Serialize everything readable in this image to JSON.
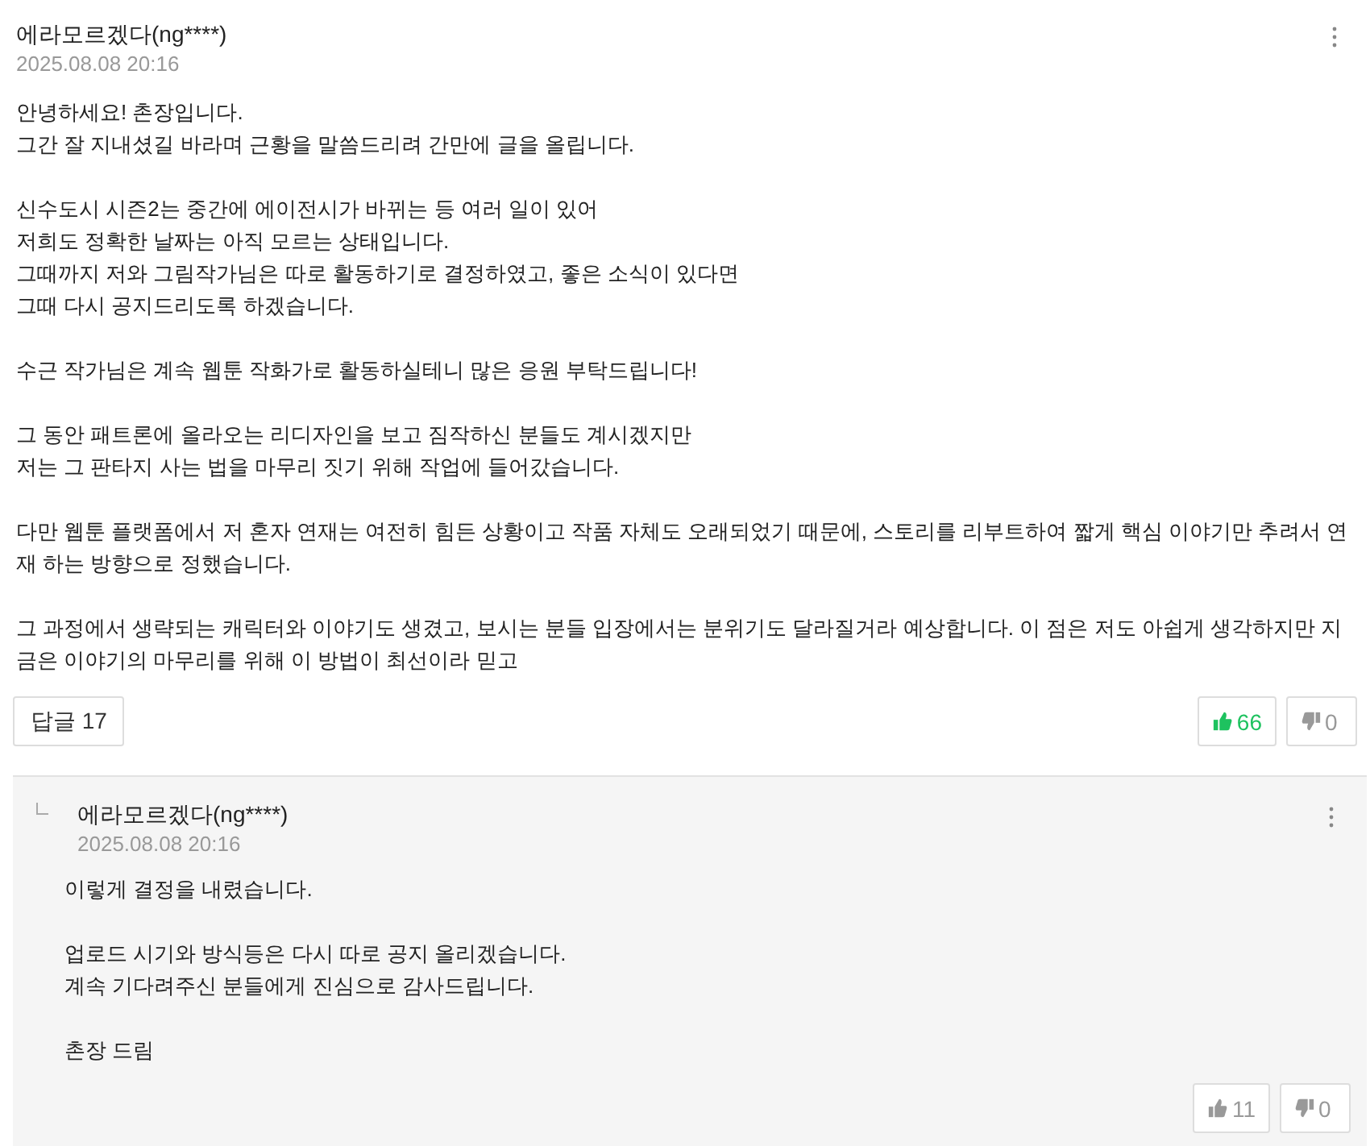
{
  "comment": {
    "author": "에라모르겠다(ng****)",
    "date": "2025.08.08 20:16",
    "paragraphs": [
      [
        "안녕하세요! 촌장입니다.",
        "그간 잘 지내셨길 바라며 근황을 말씀드리려 간만에 글을 올립니다."
      ],
      [
        "신수도시 시즌2는 중간에 에이전시가 바뀌는 등 여러 일이 있어",
        "저희도 정확한 날짜는 아직 모르는 상태입니다.",
        "그때까지 저와 그림작가님은 따로 활동하기로 결정하였고, 좋은 소식이 있다면",
        "그때 다시 공지드리도록 하겠습니다."
      ],
      [
        "수근 작가님은 계속 웹툰 작화가로 활동하실테니 많은 응원 부탁드립니다!"
      ],
      [
        "그 동안 패트론에 올라오는 리디자인을 보고 짐작하신 분들도 계시겠지만",
        "저는 그 판타지 사는 법을 마무리 짓기 위해 작업에 들어갔습니다."
      ],
      [
        "다만 웹툰 플랫폼에서 저 혼자 연재는 여전히 힘든 상황이고 작품 자체도 오래되었기 때문에, 스토리를 리부트하여 짧게 핵심 이야기만 추려서 연재 하는 방향으로 정했습니다."
      ],
      [
        "그 과정에서 생략되는 캐릭터와 이야기도 생겼고, 보시는 분들 입장에서는 분위기도 달라질거라 예상합니다. 이 점은 저도 아쉽게 생각하지만 지금은 이야기의 마무리를 위해 이 방법이 최선이라 믿고"
      ]
    ],
    "replies_button": "답글 17",
    "likes": "66",
    "liked": true,
    "dislikes": "0",
    "disliked": false
  },
  "reply": {
    "author": "에라모르겠다(ng****)",
    "date": "2025.08.08 20:16",
    "paragraphs": [
      [
        "이렇게 결정을 내렸습니다."
      ],
      [
        "업로드 시기와 방식등은 다시 따로 공지 올리겠습니다.",
        "계속 기다려주신 분들에게 진심으로 감사드립니다."
      ],
      [
        "촌장 드림"
      ]
    ],
    "likes": "11",
    "liked": false,
    "dislikes": "0",
    "disliked": false
  }
}
